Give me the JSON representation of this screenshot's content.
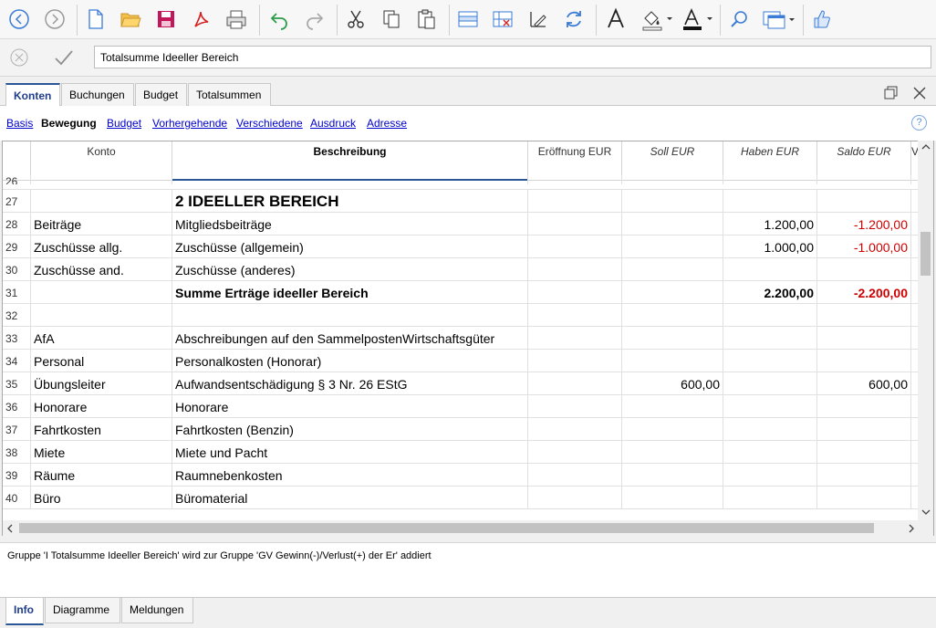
{
  "editbar": {
    "cell_value": "Totalsumme Ideeller Bereich"
  },
  "tabs": [
    "Konten",
    "Buchungen",
    "Budget",
    "Totalsummen"
  ],
  "views": [
    "Basis",
    "Bewegung",
    "Budget",
    "Vorhergehende",
    "Verschiedene",
    "Ausdruck",
    "Adresse"
  ],
  "columns": [
    "Konto",
    "Beschreibung",
    "Eröffnung EUR",
    "Soll EUR",
    "Haben EUR",
    "Saldo EUR",
    "V"
  ],
  "rows": [
    {
      "n": "26",
      "konto": "",
      "beschreibung": "",
      "eroeffnung": "",
      "soll": "",
      "haben": "",
      "saldo": ""
    },
    {
      "n": "27",
      "konto": "",
      "beschreibung": "2 IDEELLER BEREICH",
      "eroeffnung": "",
      "soll": "",
      "haben": "",
      "saldo": ""
    },
    {
      "n": "28",
      "konto": "Beiträge",
      "beschreibung": "Mitgliedsbeiträge",
      "eroeffnung": "",
      "soll": "",
      "haben": "1.200,00",
      "saldo": "-1.200,00"
    },
    {
      "n": "29",
      "konto": "Zuschüsse allg.",
      "beschreibung": "Zuschüsse (allgemein)",
      "eroeffnung": "",
      "soll": "",
      "haben": "1.000,00",
      "saldo": "-1.000,00"
    },
    {
      "n": "30",
      "konto": "Zuschüsse and.",
      "beschreibung": "Zuschüsse (anderes)",
      "eroeffnung": "",
      "soll": "",
      "haben": "",
      "saldo": ""
    },
    {
      "n": "31",
      "konto": "",
      "beschreibung": "Summe Erträge ideeller Bereich",
      "eroeffnung": "",
      "soll": "",
      "haben": "2.200,00",
      "saldo": "-2.200,00"
    },
    {
      "n": "32",
      "konto": "",
      "beschreibung": "",
      "eroeffnung": "",
      "soll": "",
      "haben": "",
      "saldo": ""
    },
    {
      "n": "33",
      "konto": "AfA",
      "beschreibung": "Abschreibungen auf den SammelpostenWirtschaftsgüter",
      "eroeffnung": "",
      "soll": "",
      "haben": "",
      "saldo": ""
    },
    {
      "n": "34",
      "konto": "Personal",
      "beschreibung": "Personalkosten (Honorar)",
      "eroeffnung": "",
      "soll": "",
      "haben": "",
      "saldo": ""
    },
    {
      "n": "35",
      "konto": "Übungsleiter",
      "beschreibung": "Aufwandsentschädigung § 3 Nr. 26 EStG",
      "eroeffnung": "",
      "soll": "600,00",
      "haben": "",
      "saldo": "600,00"
    },
    {
      "n": "36",
      "konto": "Honorare",
      "beschreibung": "Honorare",
      "eroeffnung": "",
      "soll": "",
      "haben": "",
      "saldo": ""
    },
    {
      "n": "37",
      "konto": "Fahrtkosten",
      "beschreibung": "Fahrtkosten (Benzin)",
      "eroeffnung": "",
      "soll": "",
      "haben": "",
      "saldo": ""
    },
    {
      "n": "38",
      "konto": "Miete",
      "beschreibung": "Miete und Pacht",
      "eroeffnung": "",
      "soll": "",
      "haben": "",
      "saldo": ""
    },
    {
      "n": "39",
      "konto": "Räume",
      "beschreibung": "Raumnebenkosten",
      "eroeffnung": "",
      "soll": "",
      "haben": "",
      "saldo": ""
    },
    {
      "n": "40",
      "konto": "Büro",
      "beschreibung": "Büromaterial",
      "eroeffnung": "",
      "soll": "",
      "haben": "",
      "saldo": ""
    }
  ],
  "info_message": "Gruppe 'I Totalsumme Ideeller Bereich' wird zur Gruppe 'GV Gewinn(-)/Verlust(+) der Er' addiert",
  "bottom_tabs": [
    "Info",
    "Diagramme",
    "Meldungen"
  ],
  "colors": {
    "accent": "#2b5797",
    "negative": "#d00000",
    "link": "#0000cc"
  }
}
